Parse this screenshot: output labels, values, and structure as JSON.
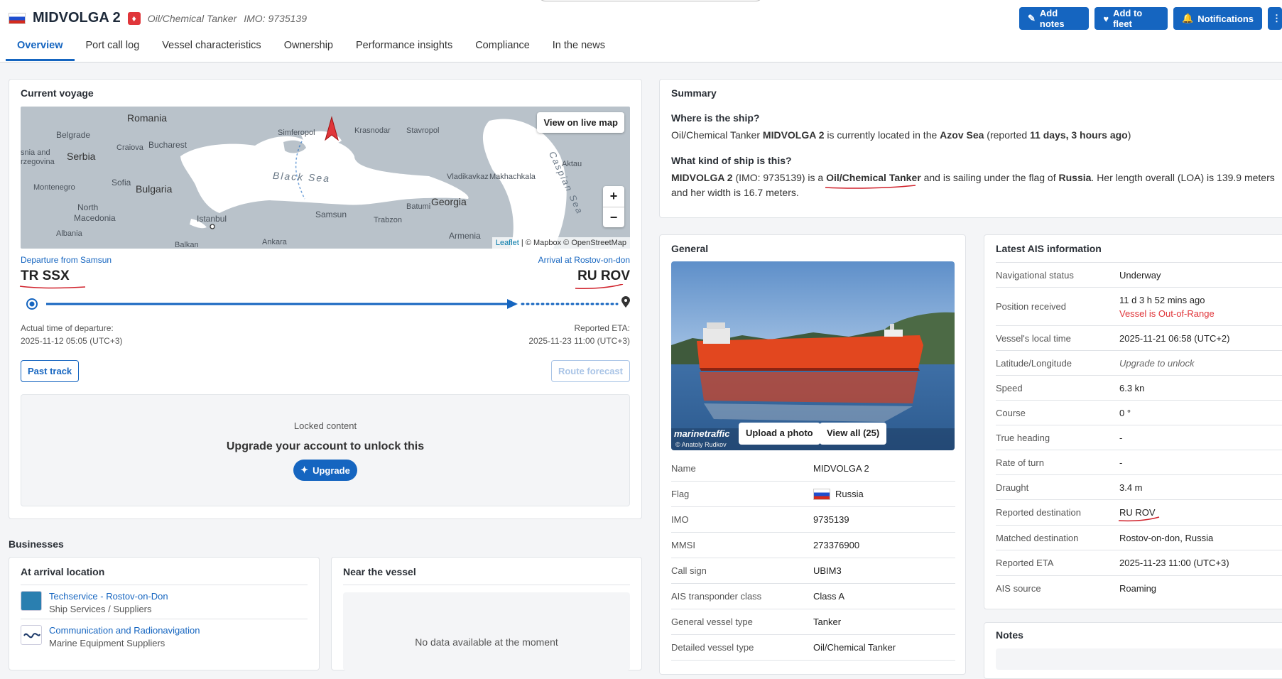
{
  "header": {
    "vessel_name": "MIDVOLGA 2",
    "vessel_type": "Oil/Chemical Tanker",
    "imo": "IMO: 9735139",
    "buttons": {
      "add_notes": "Add notes",
      "add_to_fleet": "Add to fleet",
      "notifications": "Notifications"
    }
  },
  "tabs": [
    "Overview",
    "Port call log",
    "Vessel characteristics",
    "Ownership",
    "Performance insights",
    "Compliance",
    "In the news"
  ],
  "voyage": {
    "title": "Current voyage",
    "view_on_live_map": "View on live map",
    "zoom_in": "+",
    "zoom_out": "−",
    "attribution": {
      "leaflet": "Leaflet",
      "rest": " | © Mapbox © OpenStreetMap"
    },
    "map_labels": {
      "romania": "Romania",
      "belgrade": "Belgrade",
      "craiova": "Craiova",
      "bucharest": "Bucharest",
      "serbia": "Serbia",
      "bosnia": "snia and",
      "herzegovina": "rzegovina",
      "montenegro": "Montenegro",
      "sofia": "Sofia",
      "bulgaria": "Bulgaria",
      "north_macedonia_1": "North",
      "north_macedonia_2": "Macedonia",
      "albania": "Albania",
      "istanbul": "Istanbul",
      "ankara": "Ankara",
      "samsun": "Samsun",
      "trabzon": "Trabzon",
      "batumi": "Batumi",
      "georgia": "Georgia",
      "armenia": "Armenia",
      "simferopol": "Simferopol",
      "krasnodar": "Krasnodar",
      "stavropol": "Stavropol",
      "vladikavkaz": "Vladikavkaz",
      "makhachkala": "Makhachkala",
      "aktau": "Aktau",
      "black_sea": "Black Sea",
      "caspian_sea": "Caspian Sea",
      "balkan": "Balkan"
    },
    "departure_label": "Departure from Samsun",
    "departure_port": "TR SSX",
    "arrival_label": "Arrival at Rostov-on-don",
    "arrival_port": "RU ROV",
    "atd_label": "Actual time of departure:",
    "atd_value": "2025-11-12 05:05 (UTC+3)",
    "eta_label": "Reported ETA:",
    "eta_value": "2025-11-23 11:00 (UTC+3)",
    "past_track": "Past track",
    "route_forecast": "Route forecast",
    "locked_title": "Locked content",
    "locked_message": "Upgrade your account to unlock this",
    "upgrade": "Upgrade"
  },
  "summary": {
    "title": "Summary",
    "q1": "Where is the ship?",
    "a1": {
      "p1": "Oil/Chemical Tanker ",
      "name": "MIDVOLGA 2",
      "p2": " is currently located in the ",
      "area": "Azov Sea",
      "p3": " (reported ",
      "reported": "11 days, 3 hours ago",
      "p4": ")"
    },
    "q2": "What kind of ship is this?",
    "a2": {
      "name": "MIDVOLGA 2",
      "p1": " (IMO: 9735139) is a ",
      "type": "Oil/Chemical Tanker",
      "p2": " and is sailing under the flag of ",
      "flag": "Russia",
      "p3": ". Her length overall (LOA) is 139.9 meters and her width is 16.7 meters."
    }
  },
  "general": {
    "title": "General",
    "photo_brand": "marinetraffic",
    "photo_credit": "© Anatoly Rudkov",
    "upload_photo": "Upload a photo",
    "view_all": "View all (25)",
    "rows": [
      {
        "k": "Name",
        "v": "MIDVOLGA 2"
      },
      {
        "k": "Flag",
        "v": "Russia"
      },
      {
        "k": "IMO",
        "v": "9735139"
      },
      {
        "k": "MMSI",
        "v": "273376900"
      },
      {
        "k": "Call sign",
        "v": "UBIM3"
      },
      {
        "k": "AIS transponder class",
        "v": "Class A"
      },
      {
        "k": "General vessel type",
        "v": "Tanker"
      },
      {
        "k": "Detailed vessel type",
        "v": "Oil/Chemical Tanker"
      }
    ]
  },
  "ais": {
    "title": "Latest AIS information",
    "rows": [
      {
        "k": "Navigational status",
        "v": "Underway"
      },
      {
        "k": "Position received",
        "v": "11 d 3 h 52 mins ago",
        "v2": "Vessel is Out-of-Range"
      },
      {
        "k": "Vessel's local time",
        "v": "2025-11-21 06:58 (UTC+2)"
      },
      {
        "k": "Latitude/Longitude",
        "v": "Upgrade to unlock"
      },
      {
        "k": "Speed",
        "v": "6.3 kn"
      },
      {
        "k": "Course",
        "v": "0 °"
      },
      {
        "k": "True heading",
        "v": "-"
      },
      {
        "k": "Rate of turn",
        "v": "-"
      },
      {
        "k": "Draught",
        "v": "3.4 m"
      },
      {
        "k": "Reported destination",
        "v": "RU ROV"
      },
      {
        "k": "Matched destination",
        "v": "Rostov-on-don, Russia"
      },
      {
        "k": "Reported ETA",
        "v": "2025-11-23 11:00 (UTC+3)"
      },
      {
        "k": "AIS source",
        "v": "Roaming"
      }
    ]
  },
  "notes": {
    "title": "Notes"
  },
  "businesses": {
    "title": "Businesses",
    "arrival_title": "At arrival location",
    "items": [
      {
        "name": "Techservice - Rostov-on-Don",
        "category": "Ship Services / Suppliers"
      },
      {
        "name": "Communication and Radionavigation",
        "category": "Marine Equipment Suppliers"
      }
    ],
    "near_title": "Near the vessel",
    "no_data": "No data available at the moment"
  },
  "colors": {
    "accent": "#1565c0",
    "red": "#e0363a",
    "map_sea": "#ffffff",
    "map_land": "#b9c2ca"
  }
}
